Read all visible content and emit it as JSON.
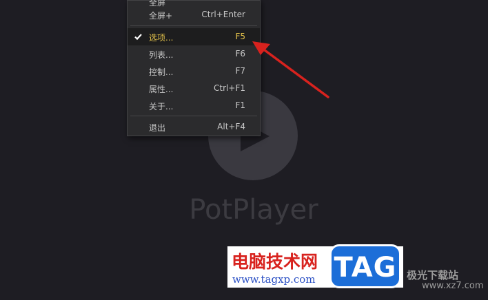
{
  "player": {
    "brand": "PotPlayer"
  },
  "menu": {
    "items": [
      {
        "label": "全屏",
        "shortcut": ""
      },
      {
        "label": "全屏+",
        "shortcut": "Ctrl+Enter"
      },
      {
        "label": "选项...",
        "shortcut": "F5",
        "checked": true,
        "highlighted": true
      },
      {
        "label": "列表...",
        "shortcut": "F6"
      },
      {
        "label": "控制...",
        "shortcut": "F7"
      },
      {
        "label": "属性...",
        "shortcut": "Ctrl+F1"
      },
      {
        "label": "关于...",
        "shortcut": "F1"
      },
      {
        "label": "退出",
        "shortcut": "Alt+F4"
      }
    ]
  },
  "annotation": {
    "arrow_color": "#d8221e"
  },
  "watermark": {
    "title": "电脑技术网",
    "url": "www.tagxp.com",
    "tag": "TAG",
    "site_cn": "极光下载站",
    "site_url": "www.xz7.com"
  },
  "colors": {
    "background": "#1e1d23",
    "menu_bg": "#2b2b2d",
    "highlight_text": "#e2c14a"
  }
}
